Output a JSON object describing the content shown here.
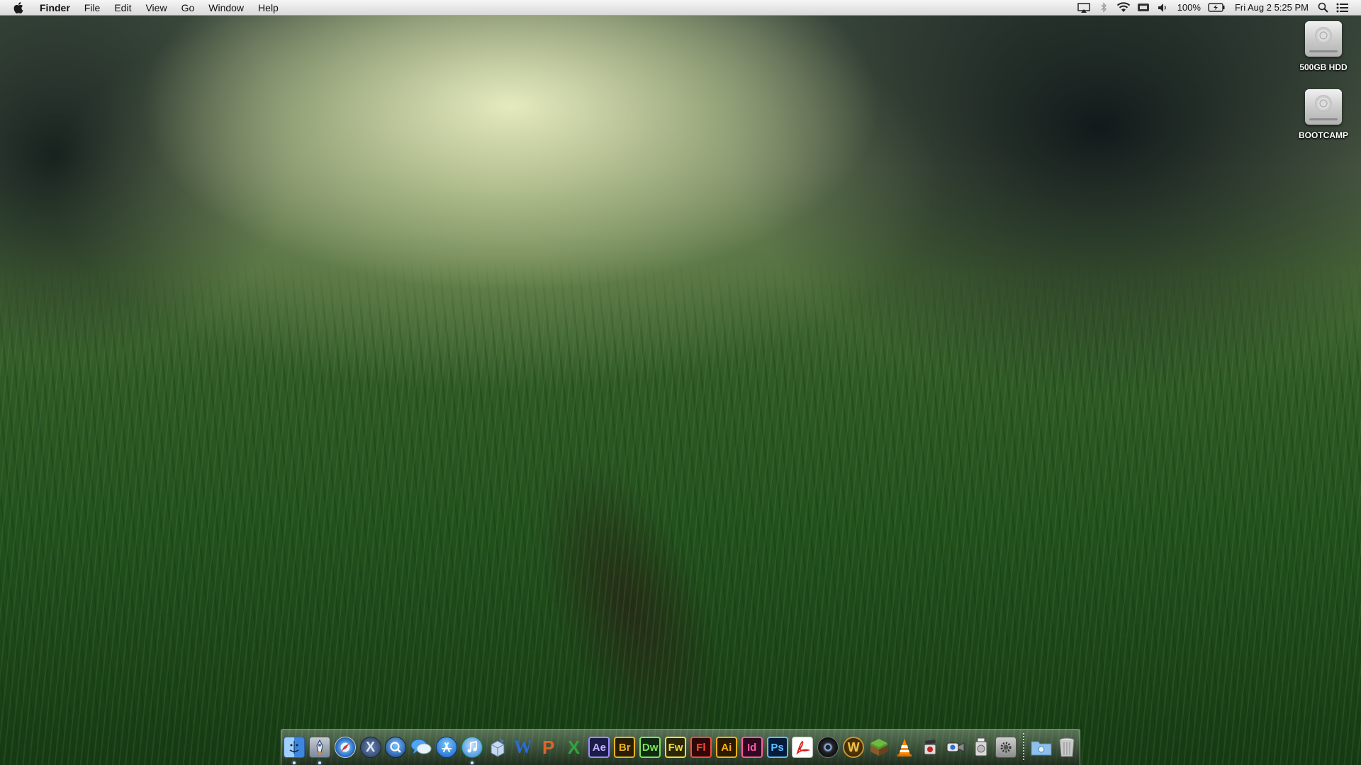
{
  "menubar": {
    "apple_icon": "apple-icon",
    "app_name": "Finder",
    "menus": [
      "File",
      "Edit",
      "View",
      "Go",
      "Window",
      "Help"
    ],
    "status": {
      "airplay_icon": "airplay-icon",
      "bluetooth_icon": "bluetooth-icon",
      "wifi_icon": "wifi-icon",
      "keyboard_icon": "keyboard-icon",
      "volume_icon": "volume-icon",
      "battery_percent": "100%",
      "battery_icon": "battery-charging-icon",
      "datetime": "Fri Aug 2  5:25 PM",
      "search_icon": "spotlight-icon",
      "notifications_icon": "notification-center-icon"
    }
  },
  "desktop": {
    "icons": [
      {
        "label": "500GB HDD",
        "icon": "hard-drive-icon"
      },
      {
        "label": "BOOTCAMP",
        "icon": "hard-drive-icon"
      }
    ]
  },
  "dock": {
    "apps": [
      {
        "name": "Finder",
        "icon": "finder-icon",
        "running": true
      },
      {
        "name": "Launchpad",
        "icon": "rocket-icon",
        "running": true
      },
      {
        "name": "Safari",
        "icon": "compass-icon",
        "running": false
      },
      {
        "name": "Mac OS X",
        "icon": "x-logo-icon",
        "running": false
      },
      {
        "name": "QuickTime",
        "icon": "quicktime-icon",
        "running": false
      },
      {
        "name": "Messages",
        "icon": "chat-bubbles-icon",
        "running": false
      },
      {
        "name": "App Store",
        "icon": "app-store-icon",
        "running": false
      },
      {
        "name": "iTunes",
        "icon": "music-note-icon",
        "running": true
      },
      {
        "name": "Package",
        "icon": "package-icon",
        "running": false
      },
      {
        "name": "Word",
        "icon": "word-icon",
        "running": false,
        "glyph": "W"
      },
      {
        "name": "PowerPoint",
        "icon": "powerpoint-icon",
        "running": false,
        "glyph": "P"
      },
      {
        "name": "Excel",
        "icon": "excel-icon",
        "running": false,
        "glyph": "X"
      },
      {
        "name": "After Effects",
        "icon": "after-effects-icon",
        "running": false,
        "glyph": "Ae"
      },
      {
        "name": "Bridge",
        "icon": "bridge-icon",
        "running": false,
        "glyph": "Br"
      },
      {
        "name": "Dreamweaver",
        "icon": "dreamweaver-icon",
        "running": false,
        "glyph": "Dw"
      },
      {
        "name": "Fireworks",
        "icon": "fireworks-icon",
        "running": false,
        "glyph": "Fw"
      },
      {
        "name": "Flash",
        "icon": "flash-icon",
        "running": false,
        "glyph": "Fl"
      },
      {
        "name": "Illustrator",
        "icon": "illustrator-icon",
        "running": false,
        "glyph": "Ai"
      },
      {
        "name": "InDesign",
        "icon": "indesign-icon",
        "running": false,
        "glyph": "Id"
      },
      {
        "name": "Photoshop",
        "icon": "photoshop-icon",
        "running": false,
        "glyph": "Ps"
      },
      {
        "name": "Acrobat",
        "icon": "acrobat-icon",
        "running": false
      },
      {
        "name": "DVD Player",
        "icon": "disc-icon",
        "running": false
      },
      {
        "name": "World of Warcraft",
        "icon": "wow-icon",
        "running": false,
        "glyph": "W"
      },
      {
        "name": "Minecraft",
        "icon": "grass-block-icon",
        "running": false
      },
      {
        "name": "VLC",
        "icon": "traffic-cone-icon",
        "running": false
      },
      {
        "name": "Utility",
        "icon": "film-slate-icon",
        "running": false
      },
      {
        "name": "Video",
        "icon": "video-camera-icon",
        "running": false
      },
      {
        "name": "Disk Utility",
        "icon": "disk-utility-icon",
        "running": false
      },
      {
        "name": "System Preferences",
        "icon": "gear-icon",
        "running": false
      }
    ],
    "stacks": [
      {
        "name": "Screenshots",
        "icon": "folder-icon"
      },
      {
        "name": "Trash",
        "icon": "trash-icon"
      }
    ]
  },
  "colors": {
    "menubar_bg": "#e9e9e9",
    "word": "#2b6bd6",
    "powerpoint": "#e0642a",
    "excel": "#2da53a",
    "after_effects": "#1b1b4a",
    "bridge": "#2a1d08",
    "dreamweaver": "#0e2b12",
    "fireworks": "#2b2608",
    "flash": "#300808",
    "illustrator": "#2a1a00",
    "indesign": "#2f0a1f",
    "photoshop": "#061b3a"
  }
}
